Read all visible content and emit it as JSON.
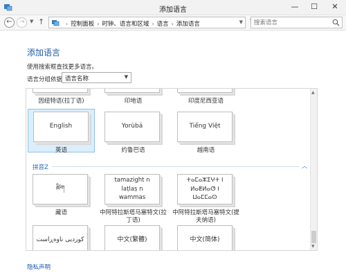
{
  "window": {
    "title": "添加语言",
    "minimize": "—",
    "maximize": "☐",
    "close": "✕"
  },
  "nav": {
    "back": "←",
    "forward": "→",
    "up": "↑",
    "breadcrumbs": [
      "控制面板",
      "时钟、语言和区域",
      "语言",
      "添加语言"
    ],
    "separator": "›",
    "refresh": "↻",
    "search_placeholder": "搜索语言"
  },
  "page": {
    "title": "添加语言",
    "hint": "使用搜索框查找更多语言。",
    "group_label": "语言分组依据:",
    "group_value": "语言名称"
  },
  "languages": {
    "partial_row": [
      {
        "name": "因纽特语(拉丁语)"
      },
      {
        "name": "印地语"
      },
      {
        "name": "印度尼西亚语"
      }
    ],
    "row1": [
      {
        "sample": "English",
        "name": "英语",
        "selected": true
      },
      {
        "sample": "Yorùbá",
        "name": "约鲁巴语"
      },
      {
        "sample": "Tiếng Việt",
        "name": "越南语"
      }
    ],
    "section": "拼音Z",
    "collapse_icon": "︿",
    "row2": [
      {
        "sample": "ཚིག",
        "name": "藏语"
      },
      {
        "sample": "tamazight n laṭlaṣ n wammas",
        "name": "中阿特拉斯塔马塞特文(拉丁语)"
      },
      {
        "sample": "ⵜⴰⵎⴰⵣⵉⵖⵜ ⵏ ⵍⴰⵟⵍⴰⵚ ⵏ ⵡⴰⵎⵎⴰⵙ",
        "name": "中阿特拉斯塔马塞特文(提夫纳语)"
      }
    ],
    "row3": [
      {
        "sample": "کوردیی ناوەڕاست"
      },
      {
        "sample": "中文(繁體)"
      },
      {
        "sample": "中文(简体)"
      }
    ]
  },
  "footer": {
    "privacy": "隐私声明"
  },
  "colors": {
    "link": "#1e5aa8",
    "selected_bg": "#dceefb",
    "selected_border": "#8cc1ea"
  }
}
